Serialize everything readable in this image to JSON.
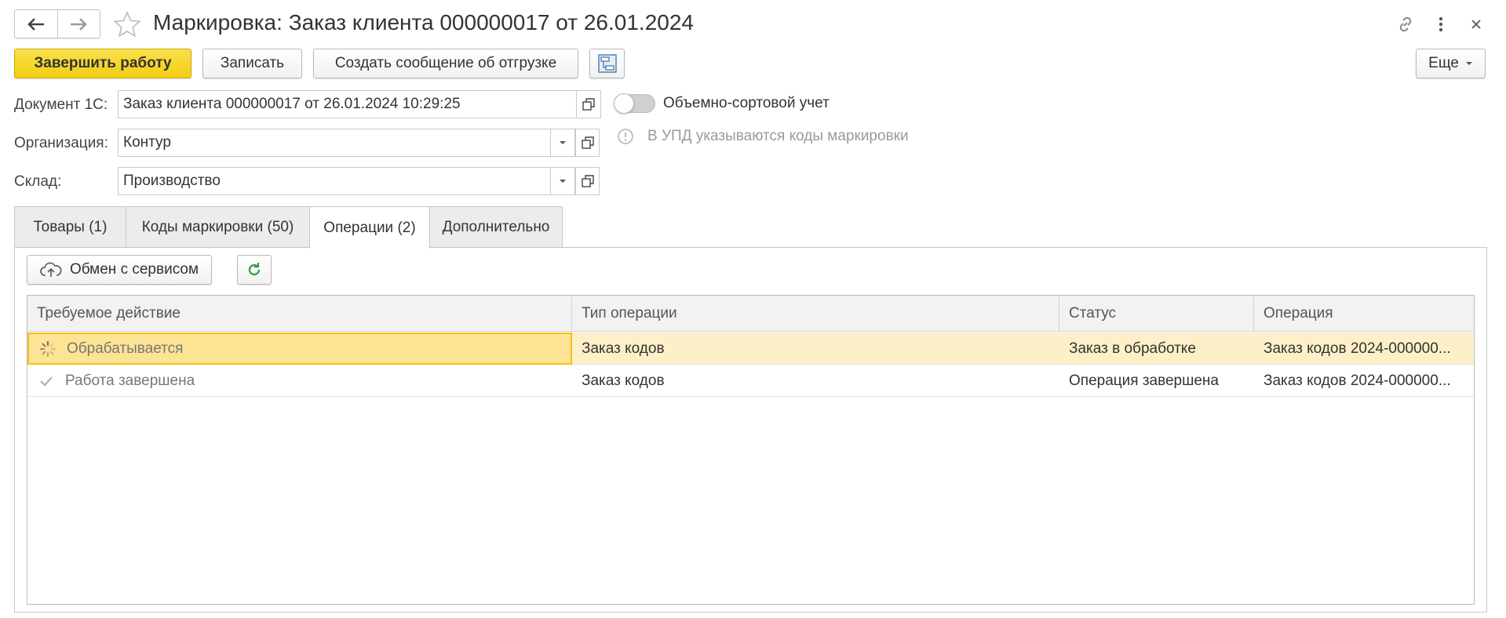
{
  "window": {
    "title": "Маркировка: Заказ клиента 000000017 от 26.01.2024"
  },
  "toolbar": {
    "finish_label": "Завершить работу",
    "save_label": "Записать",
    "create_msg_label": "Создать сообщение об отгрузке",
    "more_label": "Еще"
  },
  "form": {
    "doc_label": "Документ 1С:",
    "doc_value": "Заказ клиента 000000017 от 26.01.2024 10:29:25",
    "org_label": "Организация:",
    "org_value": "Контур",
    "warehouse_label": "Склад:",
    "warehouse_value": "Производство",
    "toggle_label": "Объемно-сортовой учет",
    "toggle_on": false,
    "info_text": "В УПД указываются коды маркировки"
  },
  "tabs": [
    {
      "label": "Товары (1)",
      "active": false
    },
    {
      "label": "Коды маркировки (50)",
      "active": false
    },
    {
      "label": "Операции (2)",
      "active": true
    },
    {
      "label": "Дополнительно",
      "active": false
    }
  ],
  "operations": {
    "exchange_label": "Обмен с сервисом",
    "columns": [
      "Требуемое действие",
      "Тип операции",
      "Статус",
      "Операция"
    ],
    "rows": [
      {
        "action": "Обрабатывается",
        "icon": "spinner-icon",
        "type": "Заказ кодов",
        "status": "Заказ в обработке",
        "operation": "Заказ кодов 2024-000000..."
      },
      {
        "action": "Работа завершена",
        "icon": "check-icon",
        "type": "Заказ кодов",
        "status": "Операция завершена",
        "operation": "Заказ кодов 2024-000000..."
      }
    ]
  },
  "colors": {
    "accent": "#f2cd13",
    "selected_row": "#fdf0c8",
    "focus_cell": "#fde394"
  }
}
